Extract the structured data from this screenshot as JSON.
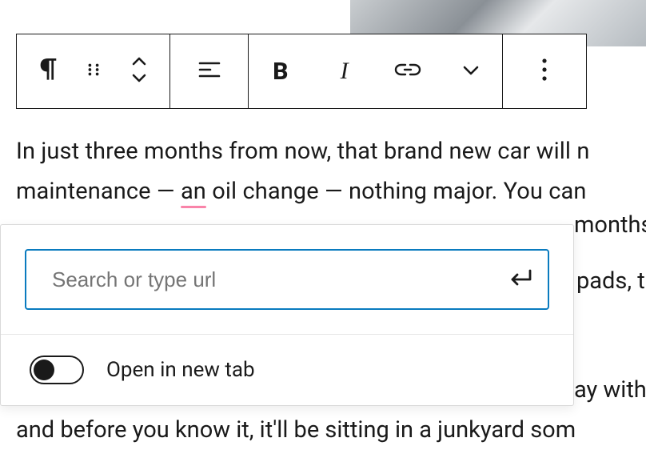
{
  "toolbar": {
    "block_type_icon": "paragraph-icon",
    "drag_icon": "drag-handle-icon",
    "move_icon": "move-up-down-icon",
    "align_icon": "align-left-icon",
    "bold_label": "B",
    "italic_label": "I",
    "link_icon": "link-icon",
    "more_formatting_icon": "chevron-down-icon",
    "options_icon": "more-vertical-icon"
  },
  "content": {
    "line1_a": "In just three months from now, that brand new car will n",
    "line2_a": "maintenance — ",
    "line2_err": "an",
    "line2_b": " oil change — nothing major. You can",
    "line3_right": " months",
    "line4_right": "pads, t",
    "line5_right": "ay with",
    "line6": "and before you know it, it'll be sitting in a junkyard som"
  },
  "link_popover": {
    "placeholder": "Search or type url",
    "value": "",
    "toggle_label": "Open in new tab",
    "toggle_on": false
  }
}
